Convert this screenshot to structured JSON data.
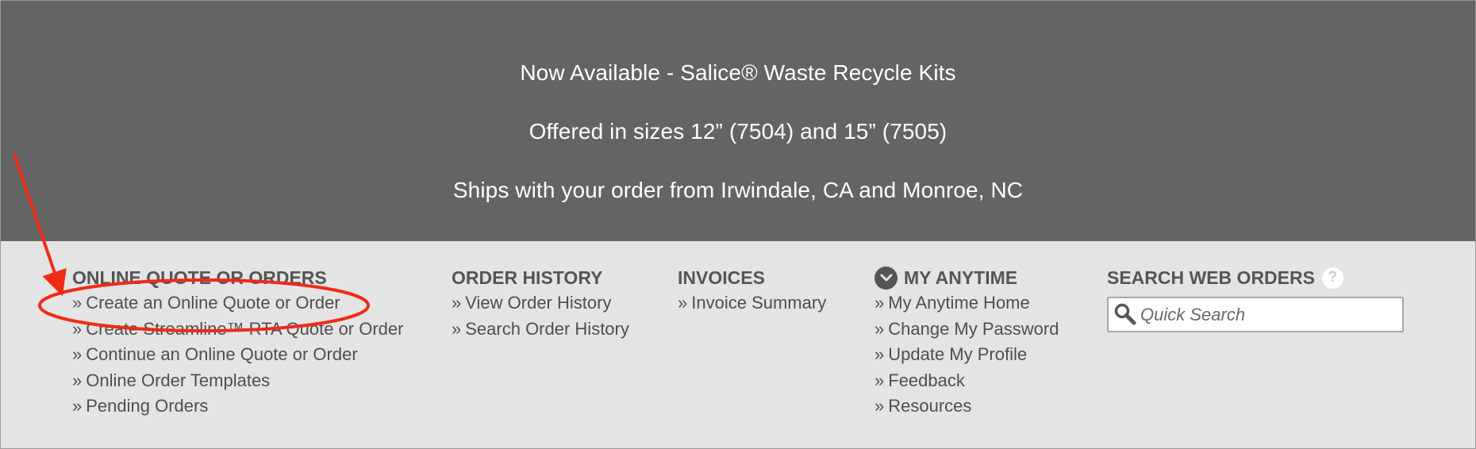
{
  "banner": {
    "line1": "Now Available - Salice® Waste Recycle Kits",
    "line2": "Offered in sizes 12” (7504) and 15” (7505)",
    "line3": "Ships with your order from Irwindale, CA and Monroe, NC"
  },
  "link_prefix": "»",
  "columns": {
    "online_quote": {
      "title": "ONLINE QUOTE OR ORDERS",
      "links": [
        "Create an Online Quote or Order",
        "Create Streamline™ RTA Quote or Order",
        "Continue an Online Quote or Order",
        "Online Order Templates",
        "Pending Orders"
      ]
    },
    "order_history": {
      "title": "ORDER HISTORY",
      "links": [
        "View Order History",
        "Search Order History"
      ]
    },
    "invoices": {
      "title": "INVOICES",
      "links": [
        "Invoice Summary"
      ]
    },
    "my_anytime": {
      "title": "MY ANYTIME",
      "icon": "chevron-down-circle-icon",
      "links": [
        "My Anytime Home",
        "Change My Password",
        "Update My Profile",
        "Feedback",
        "Resources"
      ]
    },
    "search_web_orders": {
      "title": "SEARCH WEB ORDERS",
      "help_glyph": "?",
      "search_placeholder": "Quick Search",
      "search_value": ""
    }
  },
  "colors": {
    "banner_bg": "#646464",
    "links_bg": "#e4e4e4",
    "heading_text": "#555555",
    "link_text": "#4f4f4f",
    "annotation_red": "#ef2b16"
  }
}
